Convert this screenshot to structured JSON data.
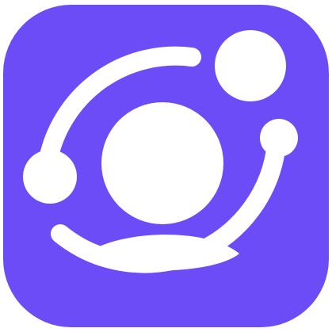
{
  "icon": {
    "semantic": "user-orbit-icon",
    "colors": {
      "background": "#6b4cf6",
      "foreground": "#ffffff"
    }
  }
}
